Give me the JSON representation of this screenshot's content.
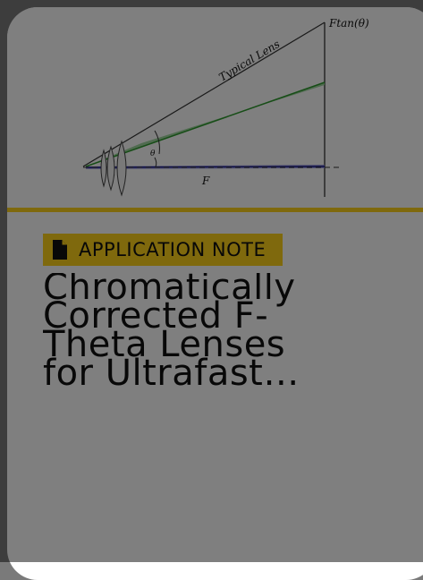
{
  "card": {
    "figure": {
      "label_ftan": "Ftan(θ)",
      "label_typical_lens": "Typical Lens",
      "label_theta": "θ",
      "label_f": "F"
    },
    "badge": {
      "icon": "document-icon",
      "label": "APPLICATION NOTE"
    },
    "title": "Chromatically Corrected F-Theta Lenses for Ultrafast…"
  },
  "colors": {
    "accent": "#ffd21a",
    "overlay": "rgba(0,0,0,0.5)"
  }
}
